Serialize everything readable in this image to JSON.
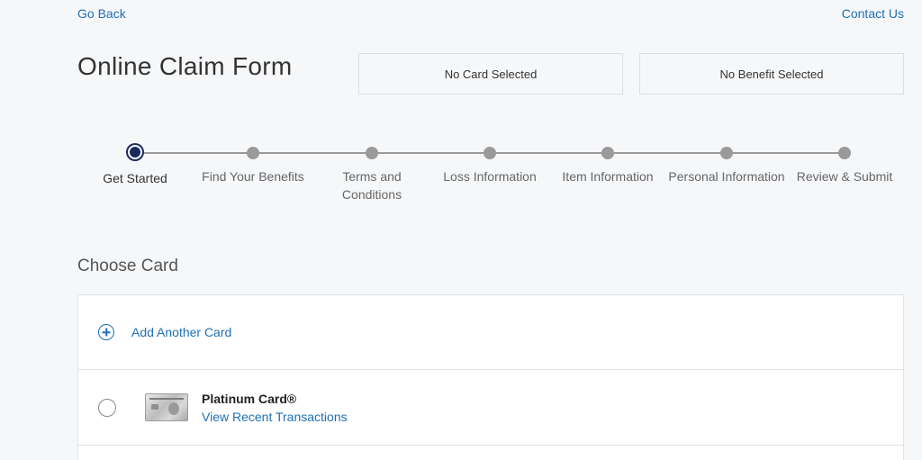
{
  "nav": {
    "go_back": "Go Back",
    "contact_us": "Contact Us"
  },
  "header": {
    "title": "Online Claim Form",
    "card_selection": "No Card Selected",
    "benefit_selection": "No Benefit Selected"
  },
  "stepper": {
    "steps": [
      {
        "label": "Get Started",
        "active": true
      },
      {
        "label": "Find Your Benefits",
        "active": false
      },
      {
        "label": "Terms and Conditions",
        "active": false
      },
      {
        "label": "Loss Information",
        "active": false
      },
      {
        "label": "Item Information",
        "active": false
      },
      {
        "label": "Personal Information",
        "active": false
      },
      {
        "label": "Review & Submit",
        "active": false
      }
    ]
  },
  "choose_card": {
    "title": "Choose Card",
    "add_label": "Add Another Card",
    "cards": [
      {
        "name": "Platinum Card®",
        "link": "View Recent Transactions"
      }
    ]
  },
  "colors": {
    "link": "#1f6fb5",
    "active_step": "#1a2a5c",
    "inactive_step": "#9a9a9a",
    "background": "#f6f7f9"
  },
  "icons": {
    "add": "plus-circle-icon",
    "card": "platinum-card-image"
  }
}
